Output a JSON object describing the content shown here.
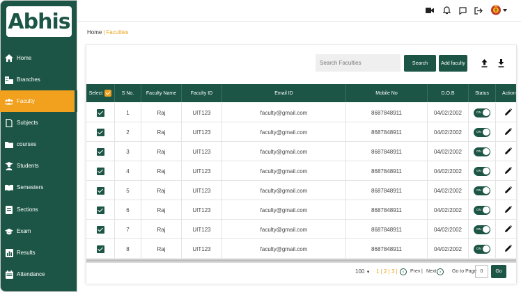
{
  "app": {
    "logo_text": "Abhis"
  },
  "sidebar": {
    "items": [
      {
        "label": "Home",
        "icon": "home-icon",
        "active": false
      },
      {
        "label": "Branches",
        "icon": "building-icon",
        "active": false
      },
      {
        "label": "Faculty",
        "icon": "people-icon",
        "active": true
      },
      {
        "label": "Subjects",
        "icon": "document-icon",
        "active": false
      },
      {
        "label": "courses",
        "icon": "folder-icon",
        "active": false
      },
      {
        "label": "Students",
        "icon": "student-icon",
        "active": false
      },
      {
        "label": "Semesters",
        "icon": "book-icon",
        "active": false
      },
      {
        "label": "Sections",
        "icon": "sections-icon",
        "active": false
      },
      {
        "label": "Exam",
        "icon": "graduation-cap-icon",
        "active": false
      },
      {
        "label": "Results",
        "icon": "results-icon",
        "active": false
      },
      {
        "label": "Attendance",
        "icon": "calendar-icon",
        "active": false
      }
    ]
  },
  "topbar": {
    "icons": [
      "video-icon",
      "bell-icon",
      "chat-icon",
      "logout-icon",
      "avatar-emblem-icon",
      "caret-down-icon"
    ]
  },
  "breadcrumb": {
    "home": "Home",
    "separator": "|",
    "current": "Faculties"
  },
  "toolbar": {
    "search_placeholder": "Search Faculties",
    "search_button": "Search",
    "add_button": "Add faculty",
    "upload_icon": "upload-icon",
    "download_icon": "download-icon"
  },
  "table": {
    "headers": {
      "select": "Select",
      "sno": "S No.",
      "name": "Faculty Name",
      "id": "Faculty ID",
      "email": "Email ID",
      "mobile": "Mobile No",
      "dob": "D.O.B",
      "status": "Status",
      "action": "Action"
    },
    "rows": [
      {
        "checked": true,
        "sno": "1",
        "name": "Raj",
        "id": "UIT123",
        "email": "faculty@gmail.com",
        "mobile": "8687848911",
        "dob": "04/02/2002",
        "status": "ON"
      },
      {
        "checked": true,
        "sno": "2",
        "name": "Raj",
        "id": "UIT123",
        "email": "faculty@gmail.com",
        "mobile": "8687848911",
        "dob": "04/02/2002",
        "status": "ON"
      },
      {
        "checked": true,
        "sno": "3",
        "name": "Raj",
        "id": "UIT123",
        "email": "faculty@gmail.com",
        "mobile": "8687848911",
        "dob": "04/02/2002",
        "status": "ON"
      },
      {
        "checked": true,
        "sno": "4",
        "name": "Raj",
        "id": "UIT123",
        "email": "faculty@gmail.com",
        "mobile": "8687848911",
        "dob": "04/02/2002",
        "status": "ON"
      },
      {
        "checked": true,
        "sno": "5",
        "name": "Raj",
        "id": "UIT123",
        "email": "faculty@gmail.com",
        "mobile": "8687848911",
        "dob": "04/02/2002",
        "status": "ON"
      },
      {
        "checked": true,
        "sno": "6",
        "name": "Raj",
        "id": "UIT123",
        "email": "faculty@gmail.com",
        "mobile": "8687848911",
        "dob": "04/02/2002",
        "status": "ON"
      },
      {
        "checked": true,
        "sno": "7",
        "name": "Raj",
        "id": "UIT123",
        "email": "faculty@gmail.com",
        "mobile": "8687848911",
        "dob": "04/02/2002",
        "status": "ON"
      },
      {
        "checked": true,
        "sno": "8",
        "name": "Raj",
        "id": "UIT123",
        "email": "faculty@gmail.com",
        "mobile": "8687848911",
        "dob": "04/02/2002",
        "status": "ON"
      }
    ]
  },
  "pagination": {
    "page_size": "100",
    "pages": "1 | 2 | 3 |",
    "prev": "Prev",
    "next_sep": "|",
    "next": "Next",
    "goto_label": "Go to Page",
    "goto_value": "0",
    "go_button": "Go"
  },
  "colors": {
    "primary": "#1c5545",
    "accent": "#f1a11d"
  }
}
